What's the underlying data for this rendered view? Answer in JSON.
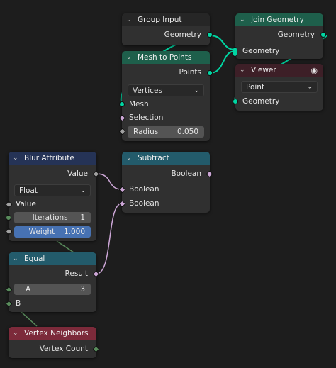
{
  "nodes": {
    "group_input": {
      "title": "Group Input",
      "outputs": [
        "Geometry"
      ]
    },
    "join_geometry": {
      "title": "Join Geometry",
      "outputs": [
        "Geometry"
      ],
      "inputs": [
        "Geometry"
      ]
    },
    "mesh_to_points": {
      "title": "Mesh to Points",
      "outputs": [
        "Points"
      ],
      "mode": "Vertices",
      "inputs": [
        "Mesh",
        "Selection"
      ],
      "radius": {
        "label": "Radius",
        "value": "0.050"
      }
    },
    "viewer": {
      "title": "Viewer",
      "domain": "Point",
      "inputs": [
        "Geometry"
      ]
    },
    "blur_attribute": {
      "title": "Blur Attribute",
      "outputs": [
        "Value"
      ],
      "data_type": "Float",
      "inputs": [
        "Value"
      ],
      "iterations": {
        "label": "Iterations",
        "value": "1"
      },
      "weight": {
        "label": "Weight",
        "value": "1.000"
      }
    },
    "subtract": {
      "title": "Subtract",
      "outputs": [
        "Boolean"
      ],
      "inputs": [
        "Boolean",
        "Boolean"
      ]
    },
    "equal": {
      "title": "Equal",
      "outputs": [
        "Result"
      ],
      "a": {
        "label": "A",
        "value": "3"
      },
      "inputs": [
        "B"
      ]
    },
    "vertex_neighbors": {
      "title": "Vertex Neighbors",
      "outputs": [
        "Vertex Count"
      ]
    }
  },
  "colors": {
    "geometry_socket": "#00d6a3",
    "boolean_socket": "#cca6d6",
    "float_socket": "#a1a1a1",
    "integer_socket": "#598c5c",
    "geometry_header": "#1e5f4b",
    "attribute_header": "#253356",
    "converter_header": "#235b6b",
    "input_header": "#7c2a3a",
    "output_header": "#3d1f27",
    "background": "#1d1d1d"
  }
}
